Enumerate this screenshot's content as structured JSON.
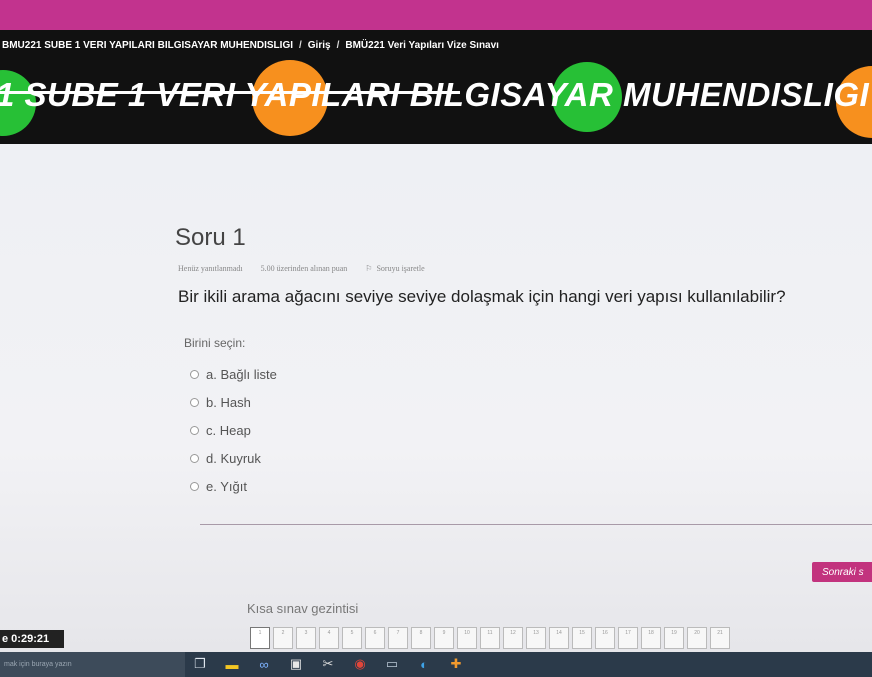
{
  "breadcrumb": {
    "course": "BMU221 SUBE 1 VERI YAPILARI BILGISAYAR MUHENDISLIGI",
    "separator": "/",
    "home": "Giriş",
    "quiz": "BMÜ221 Veri Yapıları Vize Sınavı"
  },
  "banner": {
    "title": "1 SUBE 1 VERI YAPILARI BILGISAYAR MUHENDISLIGI"
  },
  "question": {
    "title": "Soru 1",
    "status": "Henüz yanıtlanmadı",
    "points": "5.00 üzerinden alınan puan",
    "flag": "Soruyu işaretle",
    "text": "Bir ikili arama ağacını seviye seviye dolaşmak için hangi veri yapısı kullanılabilir?",
    "prompt": "Birini seçin:",
    "options": [
      "a. Bağlı liste",
      "b. Hash",
      "c. Heap",
      "d. Kuyruk",
      "e. Yığıt"
    ]
  },
  "next_button": "Sonraki s",
  "quiz_nav": {
    "title": "Kısa sınav gezintisi",
    "pages": [
      "1",
      "2",
      "3",
      "4",
      "5",
      "6",
      "7",
      "8",
      "9",
      "10",
      "11",
      "12",
      "13",
      "14",
      "15",
      "16",
      "17",
      "18",
      "19",
      "20",
      "21"
    ]
  },
  "timer": "e 0:29:21",
  "taskbar": {
    "search_placeholder": "mak için buraya yazın",
    "icons": [
      "task-view-icon",
      "media-icon",
      "link-icon",
      "store-icon",
      "app-icon",
      "chrome-icon",
      "folder-icon",
      "edge-icon",
      "settings-icon"
    ]
  },
  "colors": {
    "accent": "#c2337e",
    "green": "#27c036",
    "orange": "#f7901e"
  }
}
